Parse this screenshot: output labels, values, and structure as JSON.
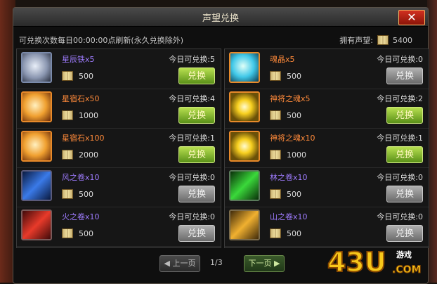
{
  "window": {
    "title": "声望兑换",
    "close_label": "✕"
  },
  "info": {
    "refresh_text": "可兑换次数每日00:00:00点刷新(永久兑换除外)",
    "rep_label": "拥有声望:",
    "rep_value": "5400"
  },
  "items_left": [
    {
      "name": "星辰铁",
      "qty": "x5",
      "color": "#9f7cff",
      "cost": "500",
      "limit": "今日可兑换:5",
      "btn": "兑换",
      "enabled": true,
      "icon": "star-iron-icon"
    },
    {
      "name": "星宿石",
      "qty": "x50",
      "color": "#ff8a3a",
      "cost": "1000",
      "limit": "今日可兑换:4",
      "btn": "兑换",
      "enabled": true,
      "icon": "star-stone-icon"
    },
    {
      "name": "星宿石",
      "qty": "x100",
      "color": "#ff8a3a",
      "cost": "2000",
      "limit": "今日可兑换:1",
      "btn": "兑换",
      "enabled": true,
      "icon": "star-stone-icon"
    },
    {
      "name": "风之卷",
      "qty": "x10",
      "color": "#9f7cff",
      "cost": "500",
      "limit": "今日可兑换:0",
      "btn": "兑换",
      "enabled": false,
      "icon": "wind-scroll-icon"
    },
    {
      "name": "火之卷",
      "qty": "x10",
      "color": "#9f7cff",
      "cost": "500",
      "limit": "今日可兑换:0",
      "btn": "兑换",
      "enabled": false,
      "icon": "fire-scroll-icon"
    }
  ],
  "items_right": [
    {
      "name": "魂晶",
      "qty": "x5",
      "color": "#ff8a3a",
      "cost": "500",
      "limit": "今日可兑换:0",
      "btn": "兑换",
      "enabled": false,
      "icon": "soul-crystal-icon"
    },
    {
      "name": "神将之魂",
      "qty": "x5",
      "color": "#ff8a3a",
      "cost": "500",
      "limit": "今日可兑换:2",
      "btn": "兑换",
      "enabled": true,
      "icon": "general-soul-icon"
    },
    {
      "name": "神将之魂",
      "qty": "x10",
      "color": "#ff8a3a",
      "cost": "1000",
      "limit": "今日可兑换:1",
      "btn": "兑换",
      "enabled": true,
      "icon": "general-soul-icon"
    },
    {
      "name": "林之卷",
      "qty": "x10",
      "color": "#9f7cff",
      "cost": "500",
      "limit": "今日可兑换:0",
      "btn": "兑换",
      "enabled": false,
      "icon": "forest-scroll-icon"
    },
    {
      "name": "山之卷",
      "qty": "x10",
      "color": "#9f7cff",
      "cost": "500",
      "limit": "今日可兑换:0",
      "btn": "兑换",
      "enabled": false,
      "icon": "mountain-scroll-icon"
    }
  ],
  "pager": {
    "prev": "上一页",
    "page": "1/3",
    "next": "下一页"
  },
  "logo": {
    "text": "43U",
    "sub": "游戏",
    "domain": ".COM"
  }
}
